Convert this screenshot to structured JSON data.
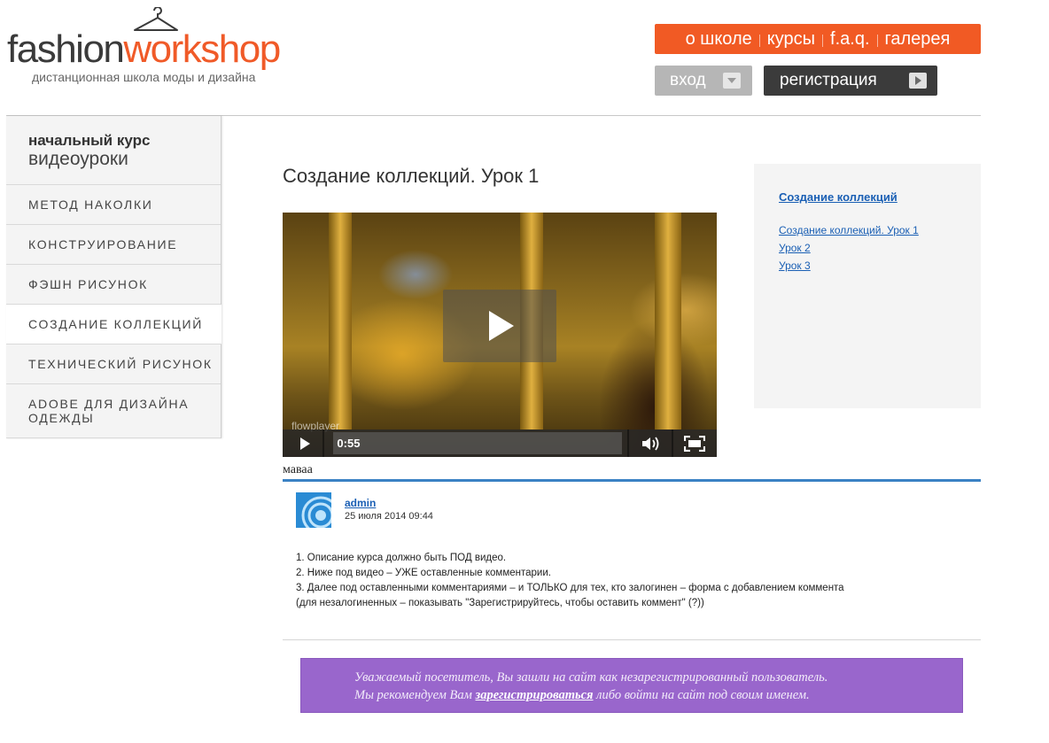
{
  "brand": {
    "logo_part1": "fashion",
    "logo_part2": "workshop",
    "tagline": "дистанционная школа моды и дизайна",
    "accent_color": "#f15a24"
  },
  "top_nav": {
    "items": [
      {
        "label": "о школе"
      },
      {
        "label": "курсы"
      },
      {
        "label": "f.a.q."
      },
      {
        "label": "галерея"
      }
    ]
  },
  "auth": {
    "login_label": "вход",
    "register_label": "регистрация"
  },
  "sidebar": {
    "heading_line1": "начальный курс",
    "heading_line2": "видеоуроки",
    "items": [
      {
        "label": "МЕТОД НАКОЛКИ",
        "active": false
      },
      {
        "label": "КОНСТРУИРОВАНИЕ",
        "active": false
      },
      {
        "label": "ФЭШН РИСУНОК",
        "active": false
      },
      {
        "label": "СОЗДАНИЕ КОЛЛЕКЦИЙ",
        "active": true
      },
      {
        "label": "ТЕХНИЧЕСКИЙ РИСУНОК",
        "active": false
      },
      {
        "label": "ADOBE ДЛЯ ДИЗАЙНА ОДЕЖДЫ",
        "active": false
      }
    ]
  },
  "main": {
    "title": "Создание коллекций. Урок 1",
    "video": {
      "brand": "flowplayer",
      "time": "0:55"
    },
    "post_label": "маваа",
    "comment": {
      "author": "admin",
      "date": "25 июля 2014 09:44",
      "lines": [
        "1. Описание курса должно быть ПОД видео.",
        "2. Ниже под видео – УЖЕ оставленные комментарии.",
        "3. Далее под оставленными комментариями – и ТОЛЬКО для тех, кто залогинен – форма с добавлением коммента",
        "(для незалогиненных – показывать \"Зарегистрируйтесь, чтобы оставить коммент\" (?))"
      ]
    },
    "notice": {
      "line1": "Уважаемый посетитель, Вы зашли на сайт как незарегистрированный пользователь.",
      "line2_before": "Мы рекомендуем Вам ",
      "line2_link": "зарегистрироваться",
      "line2_after": " либо войти на сайт под своим именем.",
      "bg_color": "#9966cc"
    }
  },
  "right_box": {
    "title": "Создание коллекций",
    "links": [
      {
        "label": "Создание коллекций. Урок 1"
      },
      {
        "label": "Урок 2"
      },
      {
        "label": "Урок 3"
      }
    ]
  }
}
